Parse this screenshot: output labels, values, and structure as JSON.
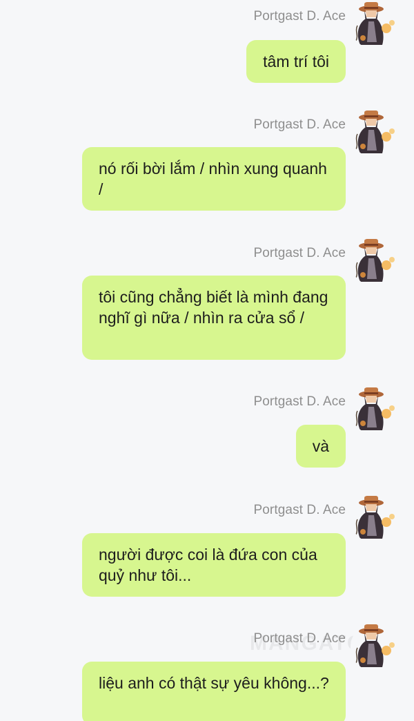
{
  "messages": [
    {
      "sender": "Portgast D. Ace",
      "text": "tâm trí tôi"
    },
    {
      "sender": "Portgast D. Ace",
      "text": "nó rối bời lắm / nhìn xung quanh /"
    },
    {
      "sender": "Portgast D. Ace",
      "text": "tôi cũng chẳng biết là mình đang nghĩ gì nữa / nhìn ra cửa sổ /"
    },
    {
      "sender": "Portgast D. Ace",
      "text": "và"
    },
    {
      "sender": "Portgast D. Ace",
      "text": "người được coi là đứa con của quỷ như tôi..."
    },
    {
      "sender": "Portgast D. Ace",
      "text": "liệu anh có thật sự yêu không...?"
    }
  ],
  "watermark": "MANGATOON",
  "colors": {
    "background": "#f6f7f9",
    "bubble": "#d7f68f",
    "sender_text": "#8e8e8e",
    "message_text": "#1d1d1d"
  },
  "icons": {
    "avatar": "character-avatar-icon"
  }
}
